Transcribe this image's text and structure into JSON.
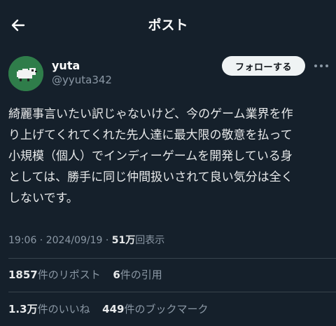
{
  "header": {
    "title": "ポスト",
    "back_icon": "arrow-left-icon"
  },
  "author": {
    "name": "yuta",
    "handle": "@yyuta342",
    "avatar_bg": "#2f7d4a"
  },
  "follow_button": {
    "label": "フォローする"
  },
  "more_icon": "more-horizontal-icon",
  "post": {
    "lines": [
      "綺麗事言いたい訳じゃないけど、今のゲーム業界を作",
      "り上げてくれてくれた先人達に最大限の敬意を払って",
      "小規模（個人）でインディーゲームを開発している身",
      "としては、勝手に同じ仲間扱いされて良い気分は全く",
      "しないです。"
    ]
  },
  "meta": {
    "time": "19:06",
    "separator1": " · ",
    "date": "2024/09/19",
    "separator2": " · ",
    "views_count": "51万",
    "views_label": "回表示"
  },
  "stats": {
    "reposts_count": "1857",
    "reposts_label": "件のリポスト",
    "quotes_count": "6",
    "quotes_label": "件の引用",
    "likes_count": "1.3万",
    "likes_label": "件のいいね",
    "bookmarks_count": "449",
    "bookmarks_label": "件のブックマーク"
  },
  "colors": {
    "background": "#15202b",
    "text": "#e7e9ea",
    "secondary": "#8b98a5",
    "divider": "#38444d"
  }
}
